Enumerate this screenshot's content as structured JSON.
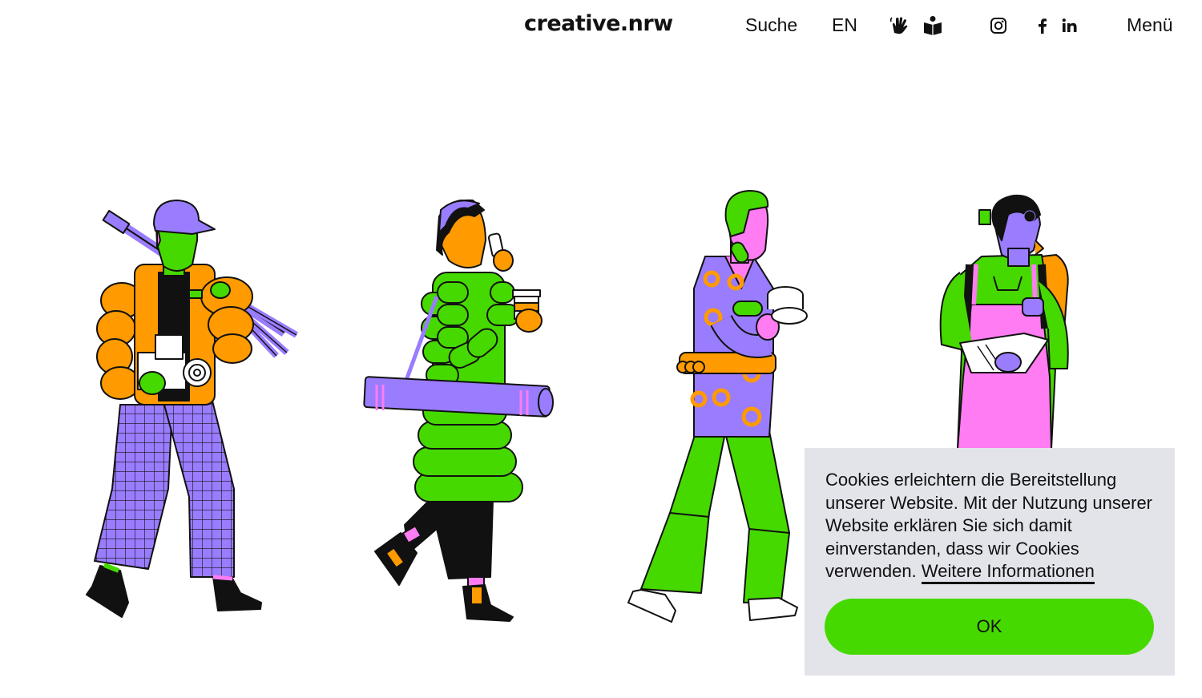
{
  "header": {
    "logo": "creative.nrw",
    "search_label": "Suche",
    "language_label": "EN",
    "menu_label": "Menü",
    "icons": [
      "sign-language-icon",
      "easy-read-icon",
      "instagram-icon",
      "facebook-icon",
      "linkedin-icon"
    ]
  },
  "cookie_banner": {
    "text": "Cookies erleichtern die Bereitstellung unserer Website. Mit der Nutzung unserer Website erklären Sie sich damit einverstanden, dass wir Cookies verwenden. ",
    "link_label": "Weitere Informationen",
    "ok_label": "OK"
  },
  "colors": {
    "accent_green": "#46d900",
    "orange": "#ff9a00",
    "purple": "#9a7cff",
    "pink": "#ff7cf2",
    "banner_bg": "#e3e4ea"
  }
}
